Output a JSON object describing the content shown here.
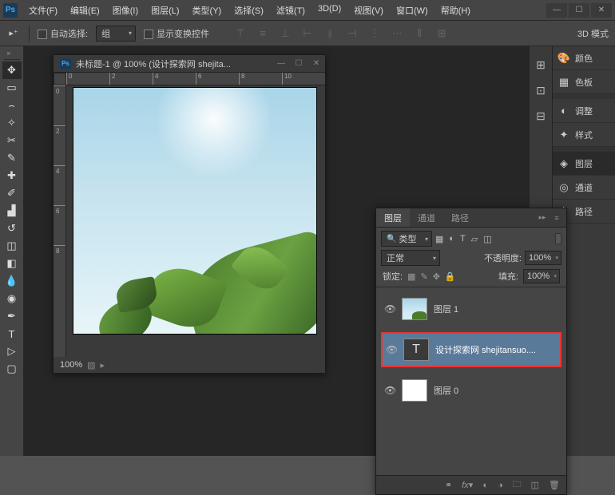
{
  "app": {
    "logo_text": "Ps"
  },
  "menu": {
    "file": "文件(F)",
    "edit": "编辑(E)",
    "image": "图像(I)",
    "layer": "图层(L)",
    "type": "类型(Y)",
    "select": "选择(S)",
    "filter": "滤镜(T)",
    "threed": "3D(D)",
    "view": "视图(V)",
    "window": "窗口(W)",
    "help": "帮助(H)"
  },
  "window_controls": {
    "min": "—",
    "max": "☐",
    "close": "✕"
  },
  "options": {
    "auto_select_label": "自动选择:",
    "group_dropdown": "组",
    "show_transform_label": "显示变换控件",
    "threed_mode": "3D 模式"
  },
  "document": {
    "title": "未标题-1 @ 100% (设计探索网 shejita...",
    "zoom": "100%",
    "ruler_ticks_h": [
      "0",
      "2",
      "4",
      "6",
      "8",
      "10"
    ],
    "ruler_ticks_v": [
      "0",
      "2",
      "4",
      "6",
      "8"
    ]
  },
  "right_panels": {
    "color": "颜色",
    "swatches": "色板",
    "adjust": "调整",
    "styles": "样式",
    "layers": "图层",
    "channels": "通道",
    "paths": "路径"
  },
  "layers_panel": {
    "tabs": {
      "layers": "图层",
      "channels": "通道",
      "paths": "路径"
    },
    "kind_filter": "类型",
    "blend_mode": "正常",
    "opacity_label": "不透明度:",
    "opacity_value": "100%",
    "lock_label": "锁定:",
    "fill_label": "填充:",
    "fill_value": "100%",
    "layers": [
      {
        "name": "图层 1",
        "type": "image"
      },
      {
        "name": "设计探索网 shejitansuo....",
        "type": "text",
        "selected": true
      },
      {
        "name": "图层 0",
        "type": "image_white"
      }
    ],
    "footer_fx": "fx"
  }
}
